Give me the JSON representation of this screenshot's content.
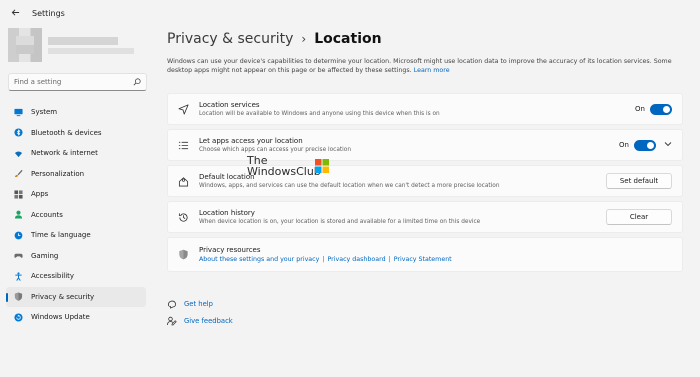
{
  "app": {
    "title": "Settings",
    "back_icon": "back-arrow-icon"
  },
  "search": {
    "placeholder": "Find a setting",
    "icon": "search-icon"
  },
  "nav": [
    {
      "label": "System",
      "icon": "monitor-icon",
      "color": "#0078d4"
    },
    {
      "label": "Bluetooth & devices",
      "icon": "bluetooth-icon",
      "color": "#0078d4"
    },
    {
      "label": "Network & internet",
      "icon": "wifi-icon",
      "color": "#0f6cbd"
    },
    {
      "label": "Personalization",
      "icon": "brush-icon",
      "color": "#d97a00"
    },
    {
      "label": "Apps",
      "icon": "apps-icon",
      "color": "#555555"
    },
    {
      "label": "Accounts",
      "icon": "person-icon",
      "color": "#1aa361"
    },
    {
      "label": "Time & language",
      "icon": "globe-clock-icon",
      "color": "#0078d4"
    },
    {
      "label": "Gaming",
      "icon": "gamepad-icon",
      "color": "#6b6b6b"
    },
    {
      "label": "Accessibility",
      "icon": "accessibility-icon",
      "color": "#0078d4"
    },
    {
      "label": "Privacy & security",
      "icon": "shield-icon",
      "color": "#6b6b6b",
      "active": true
    },
    {
      "label": "Windows Update",
      "icon": "update-icon",
      "color": "#0078d4"
    }
  ],
  "breadcrumb": {
    "parent": "Privacy & security",
    "separator": "›",
    "current": "Location"
  },
  "description": {
    "text": "Windows can use your device's capabilities to determine your location. Microsoft might use location data to improve the accuracy of its location services. Some desktop apps might not appear on this page or be affected by these settings.",
    "link": "Learn more"
  },
  "cards": {
    "location_services": {
      "title": "Location services",
      "subtitle": "Location will be available to Windows and anyone using this device when this is on",
      "toggle_label": "On",
      "icon": "location-arrow-icon"
    },
    "apps_access": {
      "title": "Let apps access your location",
      "subtitle": "Choose which apps can access your precise location",
      "toggle_label": "On",
      "icon": "list-icon",
      "chevron": "chevron-down-icon"
    },
    "default_location": {
      "title": "Default location",
      "subtitle": "Windows, apps, and services can use the default location when we can't detect a more precise location",
      "button": "Set default",
      "icon": "home-pin-icon"
    },
    "location_history": {
      "title": "Location history",
      "subtitle": "When device location is on, your location is stored and available for a limited time on this device",
      "button": "Clear",
      "icon": "history-icon"
    },
    "privacy_resources": {
      "title": "Privacy resources",
      "links": [
        "About these settings and your privacy",
        "Privacy dashboard",
        "Privacy Statement"
      ],
      "separator": "|",
      "icon": "shield-icon"
    }
  },
  "watermark": {
    "line1": "The",
    "line2": "WindowsClub"
  },
  "help": [
    {
      "label": "Get help",
      "icon": "help-icon"
    },
    {
      "label": "Give feedback",
      "icon": "feedback-icon"
    }
  ],
  "colors": {
    "accent": "#0067c0",
    "background": "#f3f3f3",
    "card": "#fbfbfb"
  }
}
